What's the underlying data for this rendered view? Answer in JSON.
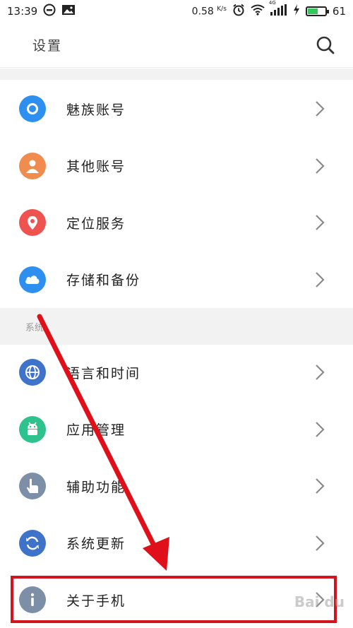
{
  "status_bar": {
    "time": "13:39",
    "net_speed": "0.58",
    "net_unit": "K/s",
    "signal_type": "4G",
    "battery_level": "61",
    "battery_fraction": 0.61,
    "icons": [
      "chat-icon",
      "image-icon",
      "alarm-icon",
      "wifi-icon",
      "signal-icon",
      "charging-icon",
      "battery-icon"
    ]
  },
  "app_bar": {
    "title": "设置",
    "search_icon": "search-icon"
  },
  "section_header": "系统",
  "account_items": [
    {
      "label": "魅族账号",
      "icon": "flyme-account-icon",
      "color": "#2d8ff0"
    },
    {
      "label": "其他账号",
      "icon": "person-icon",
      "color": "#f18c4f"
    },
    {
      "label": "定位服务",
      "icon": "location-pin-icon",
      "color": "#ef5350"
    },
    {
      "label": "存储和备份",
      "icon": "cloud-icon",
      "color": "#2d8ff0"
    }
  ],
  "system_items": [
    {
      "label": "语言和时间",
      "icon": "globe-icon",
      "color": "#3f73c9"
    },
    {
      "label": "应用管理",
      "icon": "android-icon",
      "color": "#2ec28f"
    },
    {
      "label": "辅助功能",
      "icon": "hand-pointer-icon",
      "color": "#7d8fa6"
    },
    {
      "label": "系统更新",
      "icon": "refresh-icon",
      "color": "#3f73c9"
    },
    {
      "label": "关于手机",
      "icon": "info-icon",
      "color": "#7d8fa6"
    }
  ],
  "watermark": "Bai du"
}
